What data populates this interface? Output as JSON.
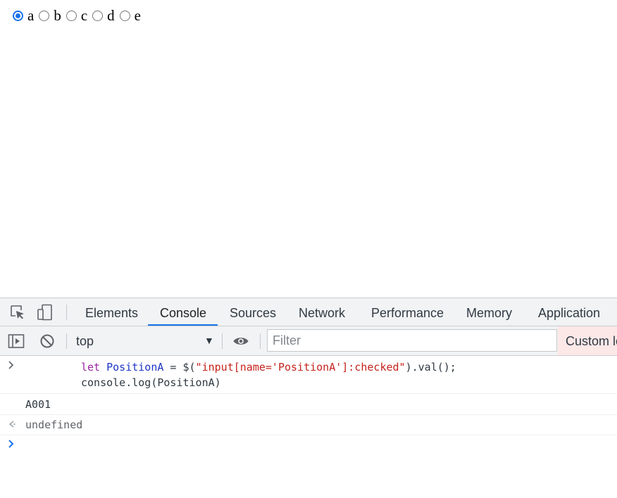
{
  "page": {
    "radio_group": {
      "name": "PositionA",
      "checked": "a",
      "options": [
        {
          "label": "a",
          "checked": true
        },
        {
          "label": "b",
          "checked": false
        },
        {
          "label": "c",
          "checked": false
        },
        {
          "label": "d",
          "checked": false
        },
        {
          "label": "e",
          "checked": false
        }
      ]
    }
  },
  "devtools": {
    "tabs": [
      {
        "label": "Elements",
        "active": false
      },
      {
        "label": "Console",
        "active": true
      },
      {
        "label": "Sources",
        "active": false
      },
      {
        "label": "Network",
        "active": false
      },
      {
        "label": "Performance",
        "active": false
      },
      {
        "label": "Memory",
        "active": false
      },
      {
        "label": "Application",
        "active": false
      }
    ],
    "toolbar": {
      "context": "top",
      "filter_placeholder": "Filter",
      "levels_label": "Custom le"
    },
    "console": {
      "input_code": {
        "line1": {
          "kw": "let",
          "var": "PositionA",
          "eq": " = $(",
          "str": "\"input[name='PositionA']:checked\"",
          "tail": ").val();"
        },
        "line2": "console.log(PositionA)"
      },
      "log_output": "A001",
      "return_value": "undefined"
    },
    "icons": {
      "inspect": "inspect-element-icon",
      "device": "device-toolbar-icon",
      "sidebar": "show-sidebar-icon",
      "clear": "clear-console-icon",
      "eye": "live-expression-eye-icon",
      "prompt": "prompt-chevron-icon",
      "return": "return-arrow-icon"
    },
    "colors": {
      "accent": "#1a73e8",
      "keyword": "#9927a4",
      "identifier": "#1c36c4",
      "string": "#c4231c"
    }
  }
}
